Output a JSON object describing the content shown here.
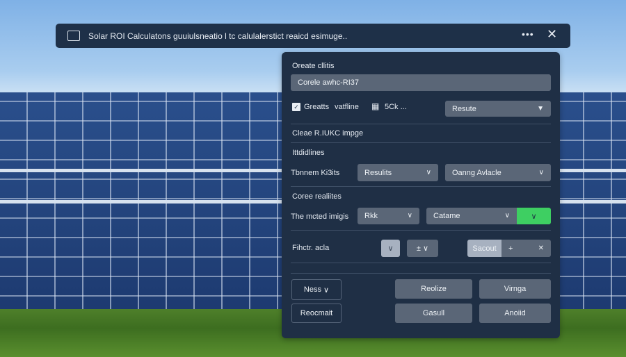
{
  "topbar": {
    "title": "Solar ROI Calculatons guuiulsneatio l tc calulalerstict reaicd esimuge..",
    "more": "•••",
    "close": "✕"
  },
  "panel": {
    "section1_label": "Oreate cllitis",
    "input_value": "Corele awhc-RI37",
    "checkbox_label": "Greatts",
    "text1": "vatfline",
    "text2": "5Ck ...",
    "select1": "Resute",
    "section2_label": "Cleae R.IUKC impge",
    "section3_label": "Ittdidlines",
    "row1_label": "Tbnnem Ki3its",
    "row1_select1": "Resulits",
    "row1_select2": "Oanng Avlacle",
    "section4_label": "Coree realiites",
    "row2_label": "The mcted imigis",
    "row2_select1": "Rkk",
    "row2_select2": "Catame",
    "row3_label": "Fihctr. acla",
    "row3_stepper": "±",
    "row3_combo": "Sacout",
    "row3_plus": "+",
    "row3_clear": "✕",
    "buttons": {
      "ness": "Ness",
      "reocmait": "Reocmait",
      "reolize": "Reolize",
      "virnga": "Virnga",
      "gasull": "Gasull",
      "anoiid": "Anoiid"
    }
  },
  "colors": {
    "accent_green": "#3ecf62",
    "panel_bg": "#1f2f45"
  }
}
